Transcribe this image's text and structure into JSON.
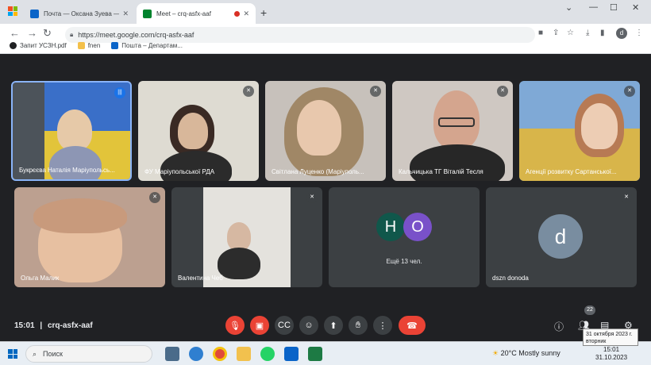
{
  "browser": {
    "tabs": [
      {
        "title": "Почта — Оксана Зуева — Outl",
        "favicon_color": "#0a64c8"
      },
      {
        "title": "Meet – crq-asfx-aaf",
        "favicon_color": "#00832d"
      }
    ],
    "address": "https://meet.google.com/crq-asfx-aaf",
    "bookmarks": [
      "Запит УСЗН.pdf",
      "fnen",
      "Пошта – Департам..."
    ],
    "profile_initial": "d"
  },
  "meeting": {
    "code": "crq-asfx-aaf",
    "time": "15:01",
    "participants_top": [
      {
        "name": "Букрєєва Наталія Маріупольсь...",
        "speaking": true
      },
      {
        "name": "ФУ Маріупольської РДА",
        "speaking": false
      },
      {
        "name": "Світлана Луценко (Маріуполь...",
        "speaking": false
      },
      {
        "name": "Кальчицька ТГ Віталій Тесля",
        "speaking": false
      },
      {
        "name": "Агенції розвитку Сартанської...",
        "speaking": false
      }
    ],
    "participants_bottom": [
      {
        "name": "Ольга Малик"
      },
      {
        "name": "Валентина Чеб"
      },
      {
        "name": "Ещё 13 чел.",
        "avatars": [
          "Н",
          "О"
        ]
      },
      {
        "name": "dszn donoda",
        "avatar": "d"
      }
    ],
    "participant_count": "22"
  },
  "colors": {
    "accent": "#1a73e8",
    "end_call": "#ea4335",
    "meet_bg": "#202124",
    "tile_bg": "#3c4043"
  },
  "taskbar": {
    "search_placeholder": "Поиск",
    "weather_temp": "20°C",
    "weather_desc": "Mostly sunny",
    "clock_time": "15:01",
    "clock_date": "31.10.2023",
    "tooltip_line1": "31 октября 2023 г.",
    "tooltip_line2": "вторник"
  }
}
